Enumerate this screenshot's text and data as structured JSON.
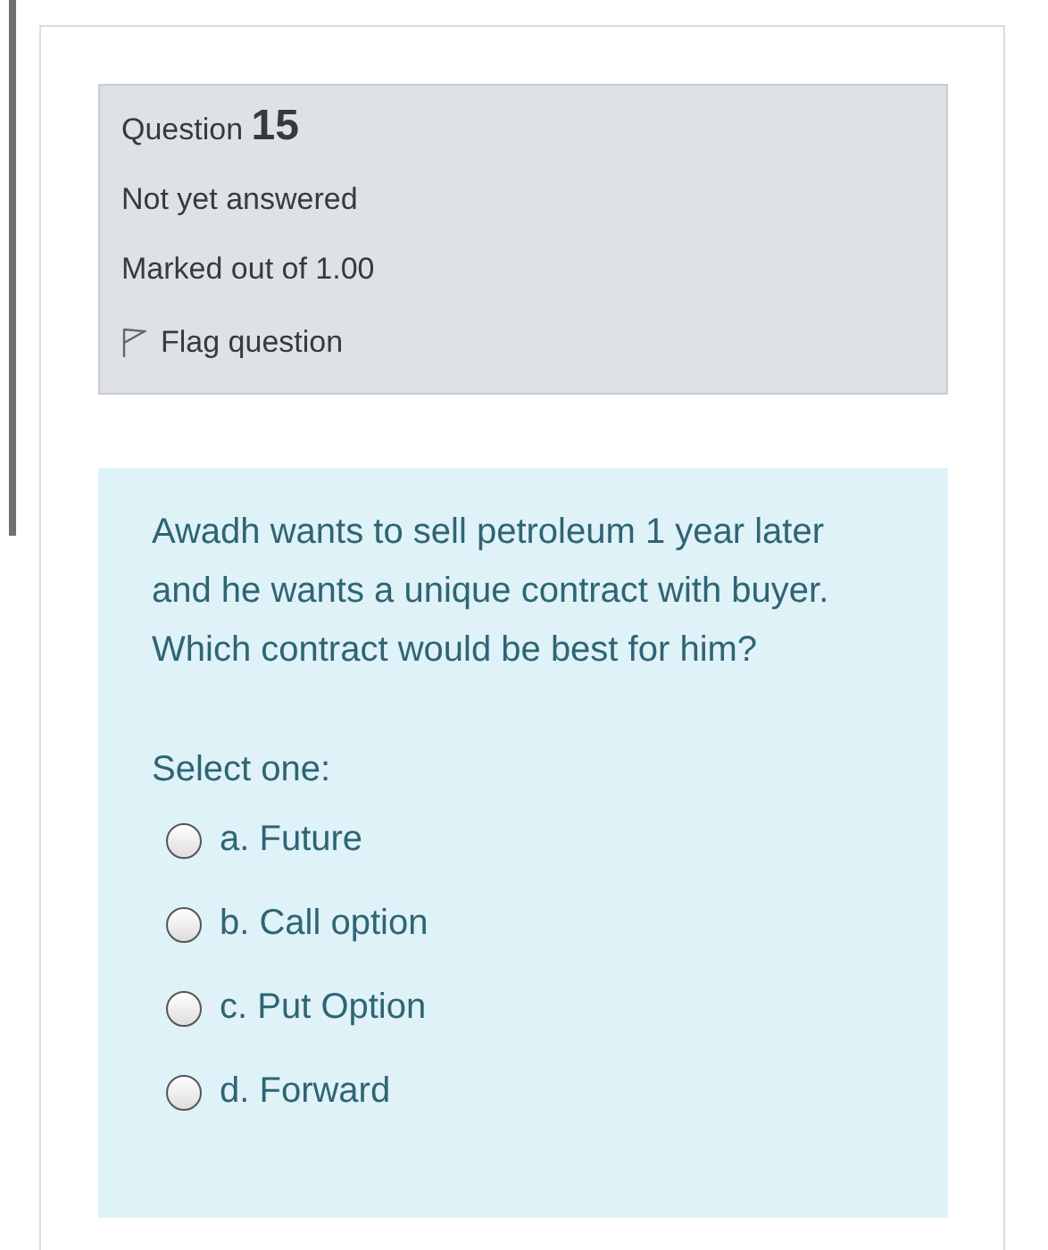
{
  "info": {
    "question_label": "Question",
    "question_number": "15",
    "state": "Not yet answered",
    "marks": "Marked out of 1.00",
    "flag": {
      "label": "Flag question",
      "flagged": false
    }
  },
  "question": {
    "text": [
      "Awadh wants to sell petroleum 1 year later and he wants a unique contract with buyer.",
      "Which contract would be best for him?"
    ],
    "prompt": "Select one:",
    "options": [
      {
        "label": "a. Future",
        "selected": false
      },
      {
        "label": "b. Call option",
        "selected": false
      },
      {
        "label": "c. Put Option",
        "selected": false
      },
      {
        "label": "d. Forward",
        "selected": false
      }
    ]
  }
}
